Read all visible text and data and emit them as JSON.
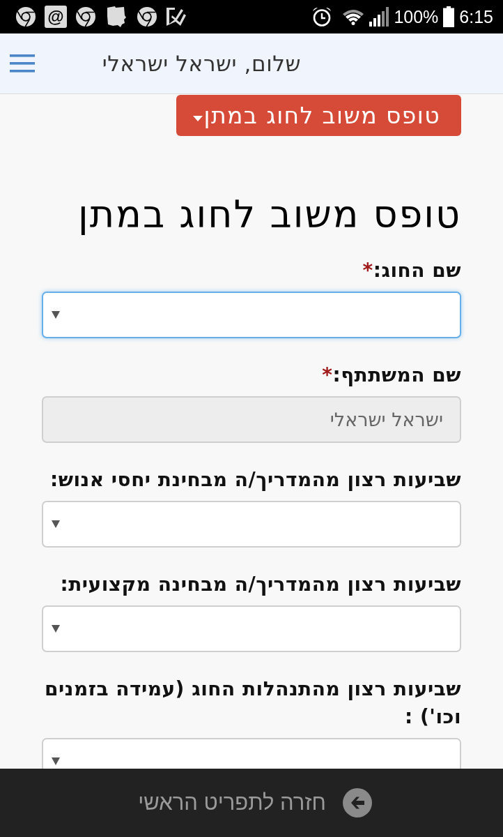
{
  "status_bar": {
    "at_glyph": "@",
    "battery": "100%",
    "time": "6:15"
  },
  "header": {
    "greeting": "שלום, ישראל ישראלי"
  },
  "form_menu_button": {
    "label": "טופס משוב לחוג במתן"
  },
  "form": {
    "title": "טופס משוב לחוג במתן",
    "fields": [
      {
        "kind": "select",
        "label": "שם החוג:",
        "required_mark": "*",
        "focused": true,
        "disabled": false
      },
      {
        "kind": "text",
        "label": "שם המשתתף:",
        "required_mark": "*",
        "value": "ישראל ישראלי",
        "focused": false,
        "disabled": true
      },
      {
        "kind": "select",
        "label": "שביעות רצון מהמדריך/ה מבחינת יחסי אנוש:",
        "focused": false,
        "disabled": false
      },
      {
        "kind": "select",
        "label": "שביעות רצון מהמדריך/ה מבחינה מקצועית:",
        "focused": false,
        "disabled": false
      },
      {
        "kind": "select",
        "label": "שביעות רצון מהתנהלות החוג (עמידה בזמנים וכו') :",
        "focused": false,
        "disabled": false
      }
    ]
  },
  "footer": {
    "back_link": "חזרה לתפריט הראשי"
  }
}
